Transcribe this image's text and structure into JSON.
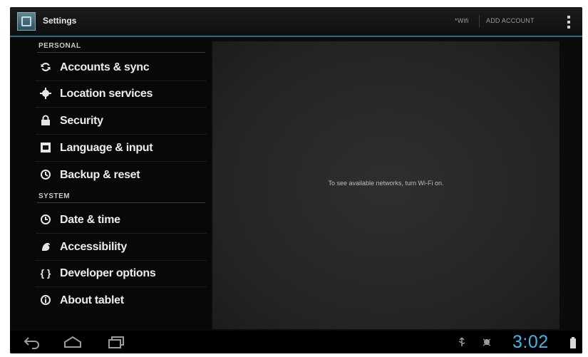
{
  "actionbar": {
    "title": "Settings",
    "app_icon": "settings-icon",
    "actions": [
      "*Wifi",
      "ADD ACCOUNT"
    ],
    "overflow_icon": "overflow-menu-icon"
  },
  "list": {
    "sections": [
      {
        "header": "PERSONAL",
        "items": [
          {
            "label": "Accounts & sync",
            "icon": "sync-icon"
          },
          {
            "label": "Location services",
            "icon": "location-icon"
          },
          {
            "label": "Security",
            "icon": "lock-icon"
          },
          {
            "label": "Language & input",
            "icon": "keyboard-icon"
          },
          {
            "label": "Backup & reset",
            "icon": "backup-icon"
          }
        ]
      },
      {
        "header": "SYSTEM",
        "items": [
          {
            "label": "Date & time",
            "icon": "clock-icon"
          },
          {
            "label": "Accessibility",
            "icon": "accessibility-icon"
          },
          {
            "label": "Developer options",
            "icon": "braces-icon"
          },
          {
            "label": "About tablet",
            "icon": "info-icon"
          }
        ]
      }
    ]
  },
  "detail": {
    "message": "To see available networks, turn Wi-Fi on."
  },
  "systembar": {
    "time": "3:02",
    "icons": [
      "back-icon",
      "home-icon",
      "recents-icon",
      "usb-icon",
      "usb-debug-icon",
      "battery-icon"
    ]
  },
  "colors": {
    "accent": "#41b6e6",
    "actionbar_rule": "#2b6d86",
    "background": "#0b0b0b"
  }
}
